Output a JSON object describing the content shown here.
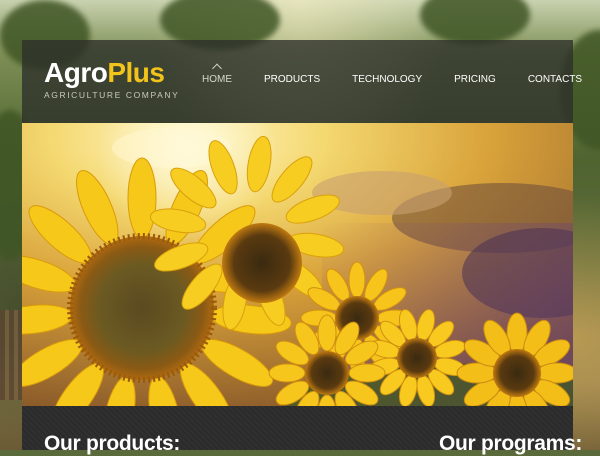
{
  "logo": {
    "brand_part1": "Agro",
    "brand_part2": "Plus",
    "tagline": "AGRICULTURE COMPANY"
  },
  "nav": {
    "items": [
      {
        "label": "HOME",
        "active": true
      },
      {
        "label": "PRODUCTS",
        "active": false
      },
      {
        "label": "TECHNOLOGY",
        "active": false
      },
      {
        "label": "PRICING",
        "active": false
      },
      {
        "label": "CONTACTS",
        "active": false
      }
    ]
  },
  "hero": {
    "image": "sunflowers-sunset"
  },
  "sections": {
    "products_title": "Our products:",
    "programs_title": "Our programs:"
  },
  "colors": {
    "accent": "#f2c31a",
    "header_bg": "#2d302a",
    "content_bg": "#2b2b2b"
  }
}
